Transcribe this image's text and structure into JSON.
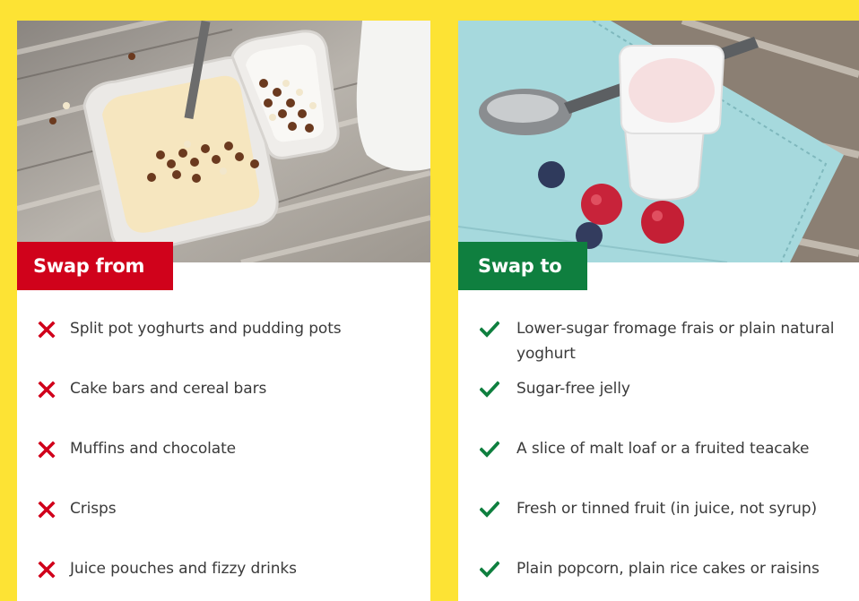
{
  "swap_from": {
    "badge": "Swap from",
    "items": [
      "Split pot yoghurts and pudding pots",
      "Cake bars and cereal bars",
      "Muffins and chocolate",
      "Crisps",
      "Juice pouches and fizzy drinks"
    ],
    "mark_icon": "cross-icon",
    "color": "#d0021b"
  },
  "swap_to": {
    "badge": "Swap to",
    "items": [
      "Lower-sugar fromage frais or plain natural yoghurt",
      "Sugar-free jelly",
      "A slice of malt loaf or a fruited teacake",
      "Fresh or tinned fruit (in juice, not syrup)",
      "Plain popcorn, plain rice cakes or raisins"
    ],
    "mark_icon": "check-icon",
    "color": "#0f7f3f"
  },
  "page": {
    "background_color": "#fde334"
  }
}
